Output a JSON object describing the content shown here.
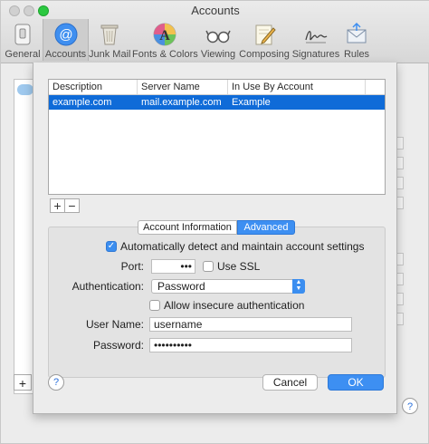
{
  "window": {
    "title": "Accounts"
  },
  "toolbar": {
    "items": [
      {
        "label": "General",
        "icon": "general-switch-icon"
      },
      {
        "label": "Accounts",
        "icon": "at-sign-icon",
        "selected": true
      },
      {
        "label": "Junk Mail",
        "icon": "trash-bin-icon"
      },
      {
        "label": "Fonts & Colors",
        "icon": "font-palette-icon"
      },
      {
        "label": "Viewing",
        "icon": "glasses-icon"
      },
      {
        "label": "Composing",
        "icon": "pencil-paper-icon"
      },
      {
        "label": "Signatures",
        "icon": "signature-icon"
      },
      {
        "label": "Rules",
        "icon": "envelope-rules-icon"
      }
    ]
  },
  "table": {
    "columns": [
      "Description",
      "Server Name",
      "In Use By Account"
    ],
    "rows": [
      {
        "description": "example.com",
        "server_name": "mail.example.com",
        "in_use_by": "Example",
        "selected": true
      }
    ]
  },
  "list_buttons": {
    "add": "+",
    "remove": "−"
  },
  "tabs": {
    "account_info": "Account Information",
    "advanced": "Advanced",
    "active": "Advanced"
  },
  "advanced": {
    "auto_detect_label": "Automatically detect and maintain account settings",
    "auto_detect_checked": true,
    "port_label": "Port:",
    "port_value": "•••",
    "use_ssl_label": "Use SSL",
    "use_ssl_checked": false,
    "authentication_label": "Authentication:",
    "authentication_value": "Password",
    "allow_insecure_label": "Allow insecure authentication",
    "allow_insecure_checked": false,
    "username_label": "User Name:",
    "username_value": "username",
    "password_label": "Password:",
    "password_value": "••••••••••"
  },
  "buttons": {
    "help": "?",
    "cancel": "Cancel",
    "ok": "OK"
  },
  "colors": {
    "accent": "#3d8ff2",
    "selection": "#0f6bd8"
  }
}
